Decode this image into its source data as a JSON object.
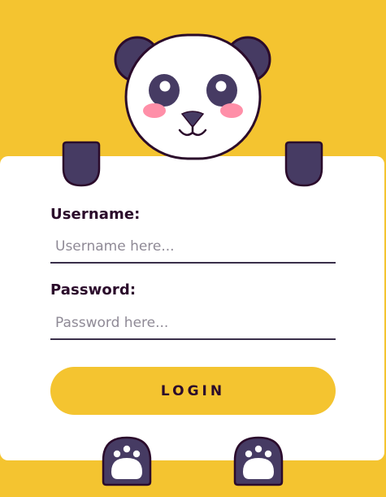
{
  "form": {
    "username_label": "Username:",
    "username_placeholder": "Username here...",
    "password_label": "Password:",
    "password_placeholder": "Password here...",
    "login_label": "LOGIN"
  },
  "colors": {
    "background": "#f4c430",
    "card": "#ffffff",
    "panda_dark": "#463b63",
    "outline": "#2b0b2b",
    "cheek": "#ff8fa8"
  },
  "icons": [
    "panda-head-icon",
    "panda-arm-icon",
    "paw-icon"
  ]
}
